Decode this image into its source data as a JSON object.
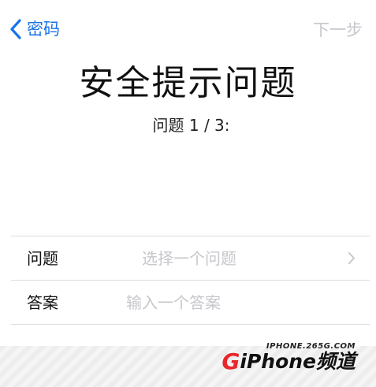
{
  "nav": {
    "back_label": "密码",
    "next_label": "下一步"
  },
  "title": "安全提示问题",
  "subtitle": "问题 1 / 3:",
  "form": {
    "question": {
      "label": "问题",
      "placeholder": "选择一个问题"
    },
    "answer": {
      "label": "答案",
      "placeholder": "输入一个答案"
    }
  },
  "watermark": {
    "url": "IPHONE.265G.COM",
    "brand_g": "G",
    "brand_rest": "iPhone频道"
  },
  "colors": {
    "accent": "#1a73e8",
    "disabled": "#c7c7cc",
    "divider": "#dcdcdf",
    "brand_red": "#e8262b"
  }
}
